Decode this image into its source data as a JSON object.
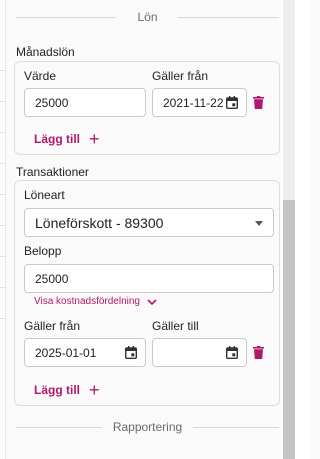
{
  "sections": {
    "salary_divider": "Lön",
    "reporting_divider": "Rapportering"
  },
  "monthly_salary": {
    "title": "Månadslön",
    "value_label": "Värde",
    "value": "25000",
    "valid_from_label": "Gäller från",
    "valid_from": "2021-11-22",
    "add_label": "Lägg till"
  },
  "transactions": {
    "title": "Transaktioner",
    "salary_type_label": "Löneart",
    "salary_type_value": "Löneförskott - 89300",
    "amount_label": "Belopp",
    "amount": "25000",
    "cost_distribution_link": "Visa kostnadsfördelning",
    "valid_from_label": "Gäller från",
    "valid_from": "2025-01-01",
    "valid_to_label": "Gäller till",
    "valid_to": "",
    "add_label": "Lägg till"
  },
  "colors": {
    "accent": "#b0186b"
  },
  "icons": [
    "calendar-icon",
    "trash-icon",
    "plus-icon",
    "chevron-down-icon",
    "caret-down-icon"
  ]
}
